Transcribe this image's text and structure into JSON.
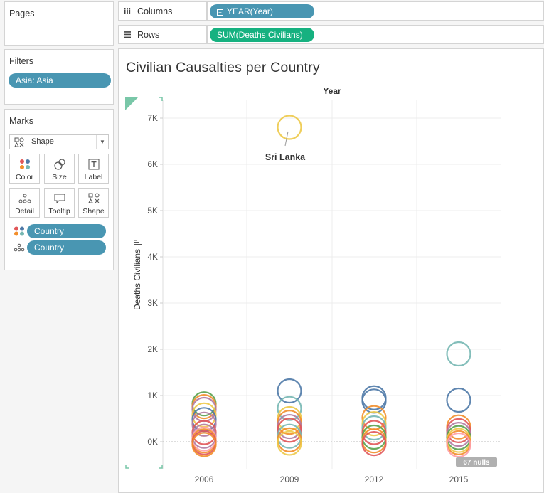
{
  "pages": {
    "title": "Pages"
  },
  "filters": {
    "title": "Filters",
    "pill": "Asia: Asia"
  },
  "marks": {
    "title": "Marks",
    "type": "Shape",
    "buttons": [
      "Color",
      "Size",
      "Label",
      "Detail",
      "Tooltip",
      "Shape"
    ],
    "fields": [
      {
        "icon": "color-dots-icon",
        "label": "Country"
      },
      {
        "icon": "detail-dots-icon",
        "label": "Country"
      }
    ]
  },
  "shelves": {
    "columns_label": "Columns",
    "columns_pill": "YEAR(Year)",
    "rows_label": "Rows",
    "rows_pill": "SUM(Deaths Civilians)"
  },
  "colors": {
    "dimension_pill": "#4996b2",
    "measure_pill": "#16b180",
    "palette": [
      "#e15759",
      "#f28e2b",
      "#edc948",
      "#59a14f",
      "#76b7b2",
      "#4e79a7",
      "#b07aa1",
      "#ff9da7",
      "#9c755f",
      "#79706e"
    ]
  },
  "chart_data": {
    "type": "scatter",
    "title": "Civilian Causalties per Country",
    "column_header": "Year",
    "ylabel": "Deaths Civilians",
    "categories": [
      "2006",
      "2009",
      "2012",
      "2015"
    ],
    "yticks": [
      "0K",
      "1K",
      "2K",
      "3K",
      "4K",
      "5K",
      "6K",
      "7K"
    ],
    "ylim": [
      -600,
      7300
    ],
    "marker": "open-circle",
    "annotation": {
      "text": "Sri Lanka",
      "category": "2009",
      "value": 6800
    },
    "nulls_badge": "67 nulls",
    "points": [
      {
        "category": "2006",
        "value": 820,
        "color": "#59a14f"
      },
      {
        "category": "2006",
        "value": 760,
        "color": "#f28e2b"
      },
      {
        "category": "2006",
        "value": 700,
        "color": "#b07aa1"
      },
      {
        "category": "2006",
        "value": 580,
        "color": "#edc948"
      },
      {
        "category": "2006",
        "value": 480,
        "color": "#4e79a7"
      },
      {
        "category": "2006",
        "value": 380,
        "color": "#b07aa1"
      },
      {
        "category": "2006",
        "value": 200,
        "color": "#e15759"
      },
      {
        "category": "2006",
        "value": 120,
        "color": "#b07aa1"
      },
      {
        "category": "2006",
        "value": 60,
        "color": "#ff9da7"
      },
      {
        "category": "2006",
        "value": 20,
        "color": "#f28e2b"
      },
      {
        "category": "2006",
        "value": -20,
        "color": "#e15759"
      },
      {
        "category": "2006",
        "value": -60,
        "color": "#f28e2b"
      },
      {
        "category": "2009",
        "value": 6800,
        "color": "#edc948"
      },
      {
        "category": "2009",
        "value": 1100,
        "color": "#4e79a7"
      },
      {
        "category": "2009",
        "value": 720,
        "color": "#76b7b2"
      },
      {
        "category": "2009",
        "value": 500,
        "color": "#edc948"
      },
      {
        "category": "2009",
        "value": 420,
        "color": "#f28e2b"
      },
      {
        "category": "2009",
        "value": 330,
        "color": "#b07aa1"
      },
      {
        "category": "2009",
        "value": 250,
        "color": "#e15759"
      },
      {
        "category": "2009",
        "value": 120,
        "color": "#76b7b2"
      },
      {
        "category": "2009",
        "value": 40,
        "color": "#f28e2b"
      },
      {
        "category": "2009",
        "value": -30,
        "color": "#edc948"
      },
      {
        "category": "2012",
        "value": 950,
        "color": "#4e79a7"
      },
      {
        "category": "2012",
        "value": 880,
        "color": "#4e79a7"
      },
      {
        "category": "2012",
        "value": 520,
        "color": "#f28e2b"
      },
      {
        "category": "2012",
        "value": 390,
        "color": "#edc948"
      },
      {
        "category": "2012",
        "value": 300,
        "color": "#76b7b2"
      },
      {
        "category": "2012",
        "value": 200,
        "color": "#e15759"
      },
      {
        "category": "2012",
        "value": 100,
        "color": "#59a14f"
      },
      {
        "category": "2012",
        "value": 20,
        "color": "#f28e2b"
      },
      {
        "category": "2012",
        "value": -40,
        "color": "#e15759"
      },
      {
        "category": "2015",
        "value": 1900,
        "color": "#76b7b2"
      },
      {
        "category": "2015",
        "value": 900,
        "color": "#4e79a7"
      },
      {
        "category": "2015",
        "value": 320,
        "color": "#f28e2b"
      },
      {
        "category": "2015",
        "value": 240,
        "color": "#e15759"
      },
      {
        "category": "2015",
        "value": 160,
        "color": "#b07aa1"
      },
      {
        "category": "2015",
        "value": 90,
        "color": "#59a14f"
      },
      {
        "category": "2015",
        "value": 30,
        "color": "#edc948"
      },
      {
        "category": "2015",
        "value": -20,
        "color": "#f28e2b"
      },
      {
        "category": "2015",
        "value": -70,
        "color": "#ff9da7"
      }
    ]
  }
}
